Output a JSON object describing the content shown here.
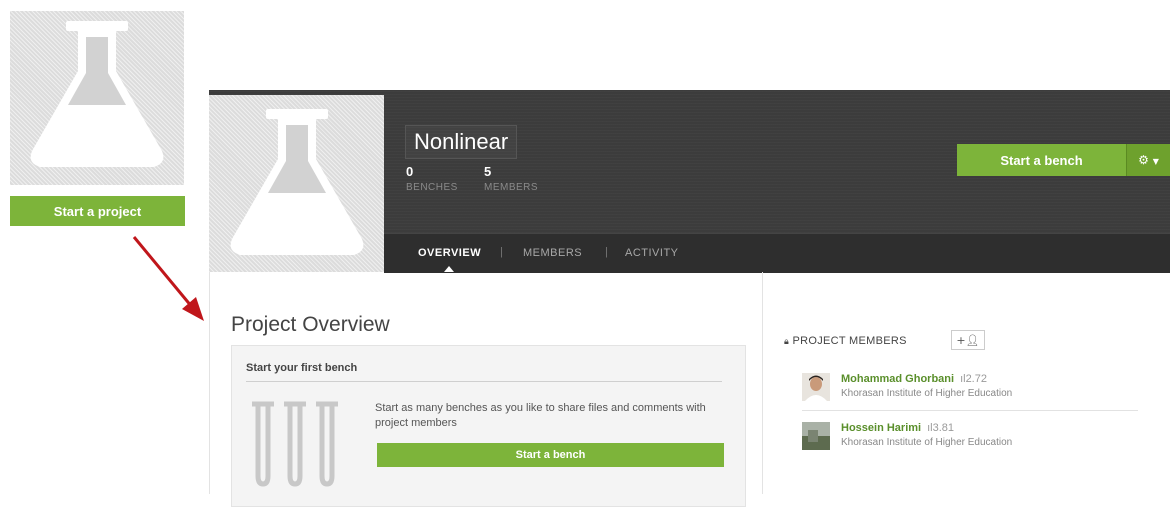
{
  "left_panel": {
    "start_project_label": "Start a project"
  },
  "header": {
    "title": "Nonlinear",
    "stats": [
      {
        "value": "0",
        "label": "BENCHES"
      },
      {
        "value": "5",
        "label": "MEMBERS"
      }
    ],
    "start_bench_label": "Start a bench",
    "settings_icon": "gear-icon"
  },
  "tabs": [
    {
      "label": "OVERVIEW",
      "active": true
    },
    {
      "label": "MEMBERS",
      "active": false
    },
    {
      "label": "ACTIVITY",
      "active": false
    }
  ],
  "tab_separator": "|",
  "overview": {
    "title": "Project Overview",
    "card": {
      "heading": "Start your first bench",
      "text": "Start as many benches as you like to share files and comments with project members",
      "button_label": "Start a bench"
    }
  },
  "members_panel": {
    "heading": "PROJECT MEMBERS",
    "members": [
      {
        "name": "Mohammad Ghorbani",
        "score": "2.72",
        "institution": "Khorasan Institute of Higher Education"
      },
      {
        "name": "Hossein Harimi",
        "score": "3.81",
        "institution": "Khorasan Institute of Higher Education"
      }
    ]
  },
  "colors": {
    "accent_green": "#7db43a",
    "header_dark": "#3c3c3c",
    "member_name": "#5a8f2b"
  }
}
